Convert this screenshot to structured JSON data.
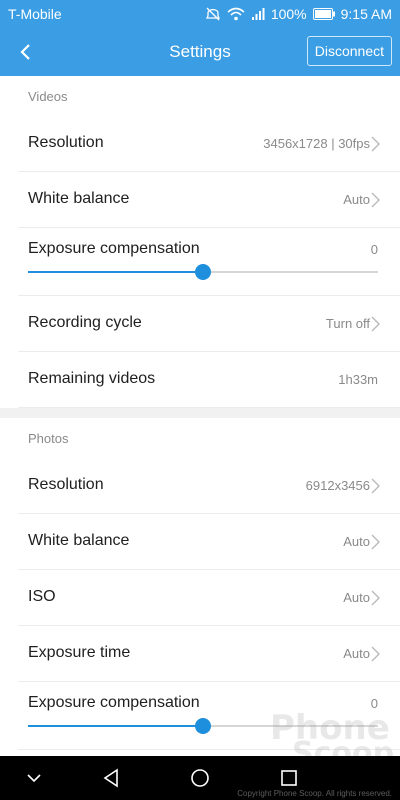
{
  "status_bar": {
    "carrier": "T-Mobile",
    "battery": "100%",
    "time": "9:15 AM",
    "icons": [
      "mute-icon",
      "wifi-icon",
      "signal-icon",
      "battery-icon"
    ]
  },
  "app_bar": {
    "title": "Settings",
    "back_icon": "back-chevron-icon",
    "disconnect_label": "Disconnect"
  },
  "videos": {
    "header": "Videos",
    "resolution": {
      "label": "Resolution",
      "value": "3456x1728 | 30fps"
    },
    "white_balance": {
      "label": "White balance",
      "value": "Auto"
    },
    "exposure": {
      "label": "Exposure compensation",
      "value": "0",
      "slider_fraction": 0.5
    },
    "recording_cycle": {
      "label": "Recording cycle",
      "value": "Turn off"
    },
    "remaining": {
      "label": "Remaining videos",
      "value": "1h33m"
    }
  },
  "photos": {
    "header": "Photos",
    "resolution": {
      "label": "Resolution",
      "value": "6912x3456"
    },
    "white_balance": {
      "label": "White balance",
      "value": "Auto"
    },
    "iso": {
      "label": "ISO",
      "value": "Auto"
    },
    "exposure_time": {
      "label": "Exposure time",
      "value": "Auto"
    },
    "exposure": {
      "label": "Exposure compensation",
      "value": "0",
      "slider_fraction": 0.5
    }
  },
  "nav_bar": {
    "icons": [
      "collapse-chevron-icon",
      "back-triangle-icon",
      "home-circle-icon",
      "recents-square-icon"
    ]
  },
  "watermark": {
    "line1": "Phone",
    "line2": "Scoop",
    "credit": "Copyright Phone Scoop. All rights reserved."
  },
  "colors": {
    "accent": "#3b9de3",
    "slider": "#1e8fdc",
    "text_primary": "#202020",
    "text_secondary": "#8a8a8a"
  }
}
